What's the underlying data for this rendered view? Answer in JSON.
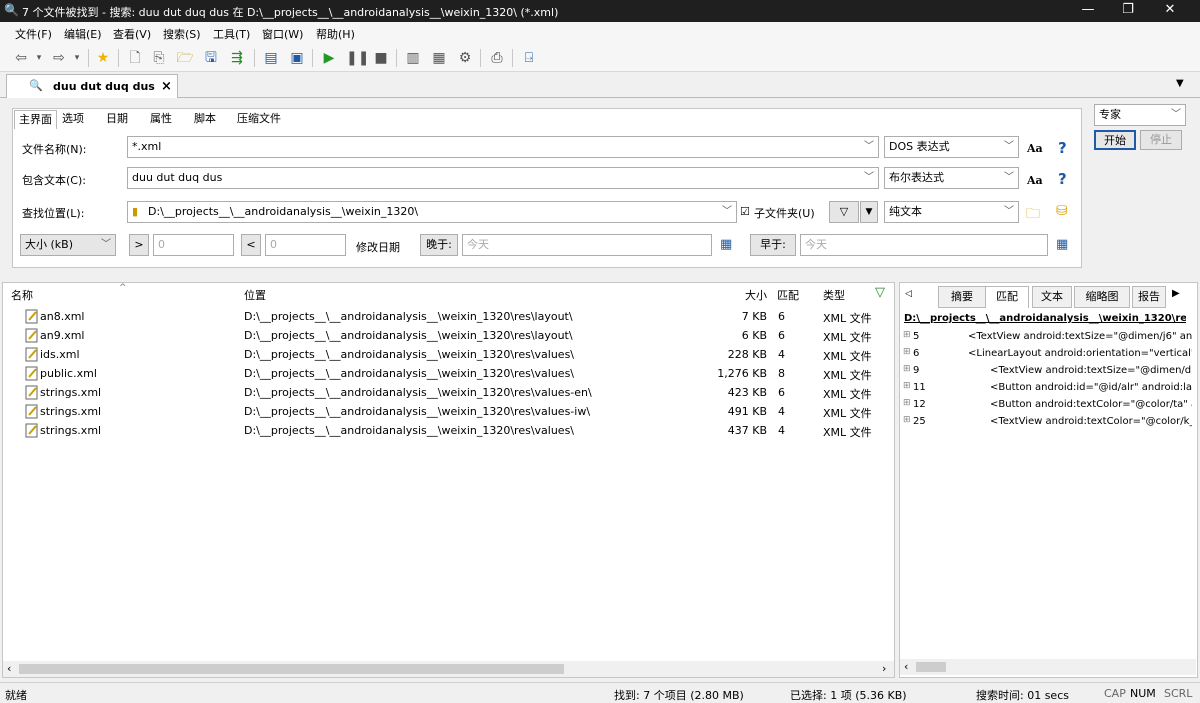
{
  "window": {
    "title": "7 个文件被找到 - 搜索: duu dut duq dus 在 D:\\__projects__\\__androidanalysis__\\weixin_1320\\ (*.xml)",
    "min": "—",
    "max": "❐",
    "close": "✕"
  },
  "menu": [
    "文件(F)",
    "编辑(E)",
    "查看(V)",
    "搜索(S)",
    "工具(T)",
    "窗口(W)",
    "帮助(H)"
  ],
  "doc_tab": {
    "label": "duu dut duq dus",
    "close": "×"
  },
  "search_tabs": [
    "主界面",
    "选项",
    "日期",
    "属性",
    "脚本",
    "压缩文件"
  ],
  "form": {
    "filename_label": "文件名称(N):",
    "filename_value": "*.xml",
    "filename_mode": "DOS 表达式",
    "content_label": "包含文本(C):",
    "content_value": "duu dut duq dus",
    "content_mode": "布尔表达式",
    "location_label": "查找位置(L):",
    "location_value": "D:\\__projects__\\__androidanalysis__\\weixin_1320\\",
    "subfolder_label": "子文件夹(U)",
    "encoding": "纯文本",
    "size_label": "大小 (kB)",
    "gt": ">",
    "lt": "<",
    "size_min": "0",
    "size_max": "0",
    "date_label": "修改日期",
    "later_label": "晚于:",
    "earlier_label": "早于:",
    "today": "今天",
    "aa": "Aa",
    "help": "?"
  },
  "right_controls": {
    "profile": "专家",
    "start": "开始",
    "stop": "停止"
  },
  "results": {
    "headers": {
      "name": "名称",
      "path": "位置",
      "size": "大小",
      "match": "匹配",
      "type": "类型"
    },
    "rows": [
      {
        "name": "an8.xml",
        "path": "D:\\__projects__\\__androidanalysis__\\weixin_1320\\res\\layout\\",
        "size": "7 KB",
        "match": "6",
        "type": "XML 文件"
      },
      {
        "name": "an9.xml",
        "path": "D:\\__projects__\\__androidanalysis__\\weixin_1320\\res\\layout\\",
        "size": "6 KB",
        "match": "6",
        "type": "XML 文件"
      },
      {
        "name": "ids.xml",
        "path": "D:\\__projects__\\__androidanalysis__\\weixin_1320\\res\\values\\",
        "size": "228 KB",
        "match": "4",
        "type": "XML 文件"
      },
      {
        "name": "public.xml",
        "path": "D:\\__projects__\\__androidanalysis__\\weixin_1320\\res\\values\\",
        "size": "1,276 KB",
        "match": "8",
        "type": "XML 文件"
      },
      {
        "name": "strings.xml",
        "path": "D:\\__projects__\\__androidanalysis__\\weixin_1320\\res\\values-en\\",
        "size": "423 KB",
        "match": "6",
        "type": "XML 文件"
      },
      {
        "name": "strings.xml",
        "path": "D:\\__projects__\\__androidanalysis__\\weixin_1320\\res\\values-iw\\",
        "size": "491 KB",
        "match": "4",
        "type": "XML 文件"
      },
      {
        "name": "strings.xml",
        "path": "D:\\__projects__\\__androidanalysis__\\weixin_1320\\res\\values\\",
        "size": "437 KB",
        "match": "4",
        "type": "XML 文件"
      }
    ]
  },
  "preview": {
    "tabs": [
      "摘要",
      "匹配",
      "文本",
      "缩略图",
      "报告"
    ],
    "path": "D:\\__projects__\\__androidanalysis__\\weixin_1320\\re",
    "lines": [
      {
        "n": "5",
        "t": "<TextView android:textSize=\"@dimen/j6\" an"
      },
      {
        "n": "6",
        "t": "<LinearLayout android:orientation=\"vertical\""
      },
      {
        "n": "9",
        "t": "<TextView android:textSize=\"@dimen/d"
      },
      {
        "n": "11",
        "t": "<Button android:id=\"@id/alr\" android:la"
      },
      {
        "n": "12",
        "t": "<Button android:textColor=\"@color/ta\" a"
      },
      {
        "n": "25",
        "t": "<TextView android:textColor=\"@color/k_"
      }
    ]
  },
  "status": {
    "ready": "就绪",
    "found": "找到: 7 个项目 (2.80 MB)",
    "selected": "已选择: 1 项 (5.36 KB)",
    "time": "搜索时间: 01 secs",
    "cap": "CAP",
    "num": "NUM",
    "scrl": "SCRL"
  },
  "colors": {
    "titlebar": "#1f1f1f",
    "accent": "#1e5aa8",
    "panel": "#f0f0f0"
  }
}
